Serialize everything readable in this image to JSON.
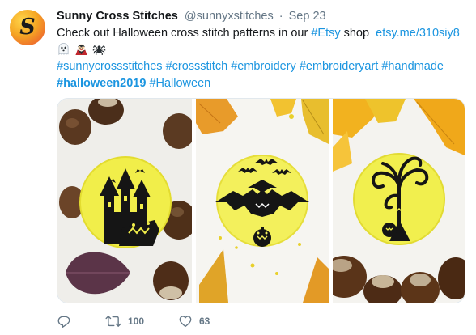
{
  "user": {
    "display_name": "Sunny Cross Stitches",
    "handle": "@sunnyxstitches",
    "separator": "·",
    "timestamp": "Sep 23",
    "avatar_letter": "S"
  },
  "tweet": {
    "text_before": "Check out Halloween cross stitch patterns in our ",
    "etsy_hashtag": "#Etsy",
    "text_mid": " shop  ",
    "link": "etsy.me/310siy8",
    "emojis": [
      "ghost",
      "vampire",
      "spider"
    ],
    "hashtags_line": [
      "#sunnycrossstitches",
      "#crossstitch",
      "#embroidery",
      "#embroideryart",
      "#handmade"
    ],
    "hashtag_bold": "#halloween2019",
    "hashtag_last": "#Halloween"
  },
  "media": {
    "images": [
      "haunted-house-moon-stitch",
      "bats-moon-stitch",
      "spooky-tree-moon-stitch"
    ]
  },
  "actions": {
    "reply_count": "",
    "retweet_count": "100",
    "like_count": "63"
  },
  "colors": {
    "link": "#1b95e0",
    "muted": "#657786",
    "text": "#14171a"
  }
}
